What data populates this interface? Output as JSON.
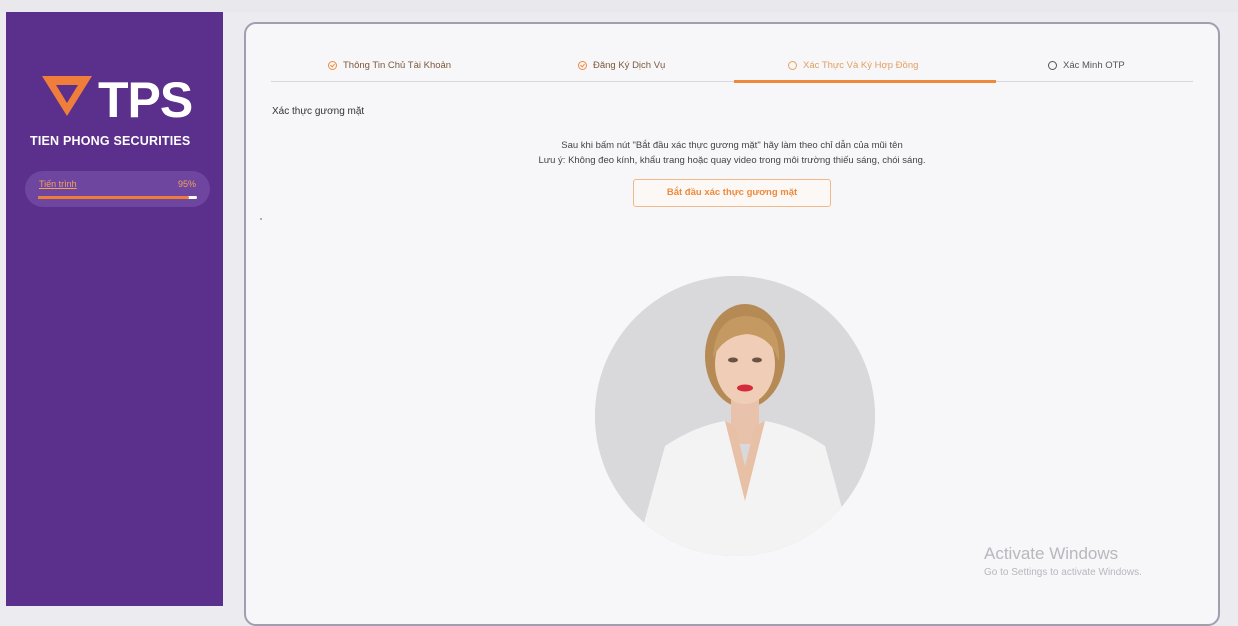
{
  "brand": {
    "logo_text": "TPS",
    "company_name": "TIEN PHONG SECURITIES",
    "colors": {
      "sidebar": "#5b2f8c",
      "accent": "#ee8a3c"
    }
  },
  "sidebar": {
    "progress_label": "Tiến trình",
    "progress_value": "95%",
    "progress_fraction": 0.95
  },
  "steps": [
    {
      "label": "Thông Tin Chủ Tài Khoản",
      "state": "done",
      "icon": "check-circle-icon"
    },
    {
      "label": "Đăng Ký Dịch Vụ",
      "state": "done",
      "icon": "check-circle-icon"
    },
    {
      "label": "Xác Thực Và Ký Hợp Đồng",
      "state": "active",
      "icon": "circle-icon"
    },
    {
      "label": "Xác Minh OTP",
      "state": "pending",
      "icon": "circle-icon"
    }
  ],
  "face_verification": {
    "title": "Xác thực gương mặt",
    "instruction_1": "Sau khi bấm nút \"Bắt đầu xác thực gương mặt\" hãy làm theo chỉ dẫn của mũi tên",
    "instruction_2": "Lưu ý: Không đeo kính, khẩu trang hoặc quay video trong môi trường thiếu sáng, chói sáng.",
    "start_button": "Bắt đầu xác thực gương mặt"
  },
  "watermark": {
    "title": "Activate Windows",
    "subtitle": "Go to Settings to activate Windows."
  }
}
